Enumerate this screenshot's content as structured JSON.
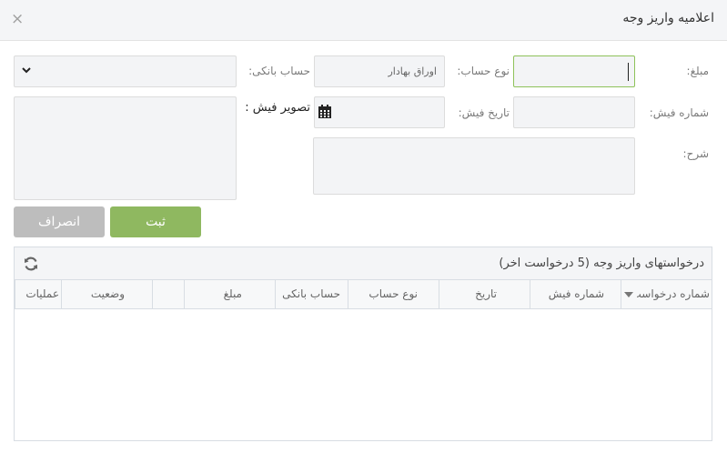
{
  "dialog": {
    "title": "اعلامیه واریز وجه",
    "close_icon": "×"
  },
  "form": {
    "amount_label": "مبلغ:",
    "account_type_label": "نوع حساب:",
    "account_type_value": "اوراق بهادار",
    "bank_account_label": "حساب بانکی:",
    "receipt_number_label": "شماره فیش:",
    "receipt_date_label": "تاریخ فیش:",
    "receipt_image_label": "تصویر فیش :",
    "description_label": "شرح:"
  },
  "buttons": {
    "save": "ثبت",
    "cancel": "انصراف"
  },
  "requests": {
    "title": "درخواستهای واریز وجه (5 درخواست اخر)",
    "columns": [
      "شماره درخواست",
      "شماره فیش",
      "تاریخ",
      "نوع حساب",
      "حساب بانکی",
      "مبلغ",
      "",
      "وضعیت",
      "عملیات"
    ]
  },
  "colors": {
    "accent_green": "#8fb860",
    "active_border": "#8ec25a",
    "cancel_gray": "#bdbdbd"
  }
}
